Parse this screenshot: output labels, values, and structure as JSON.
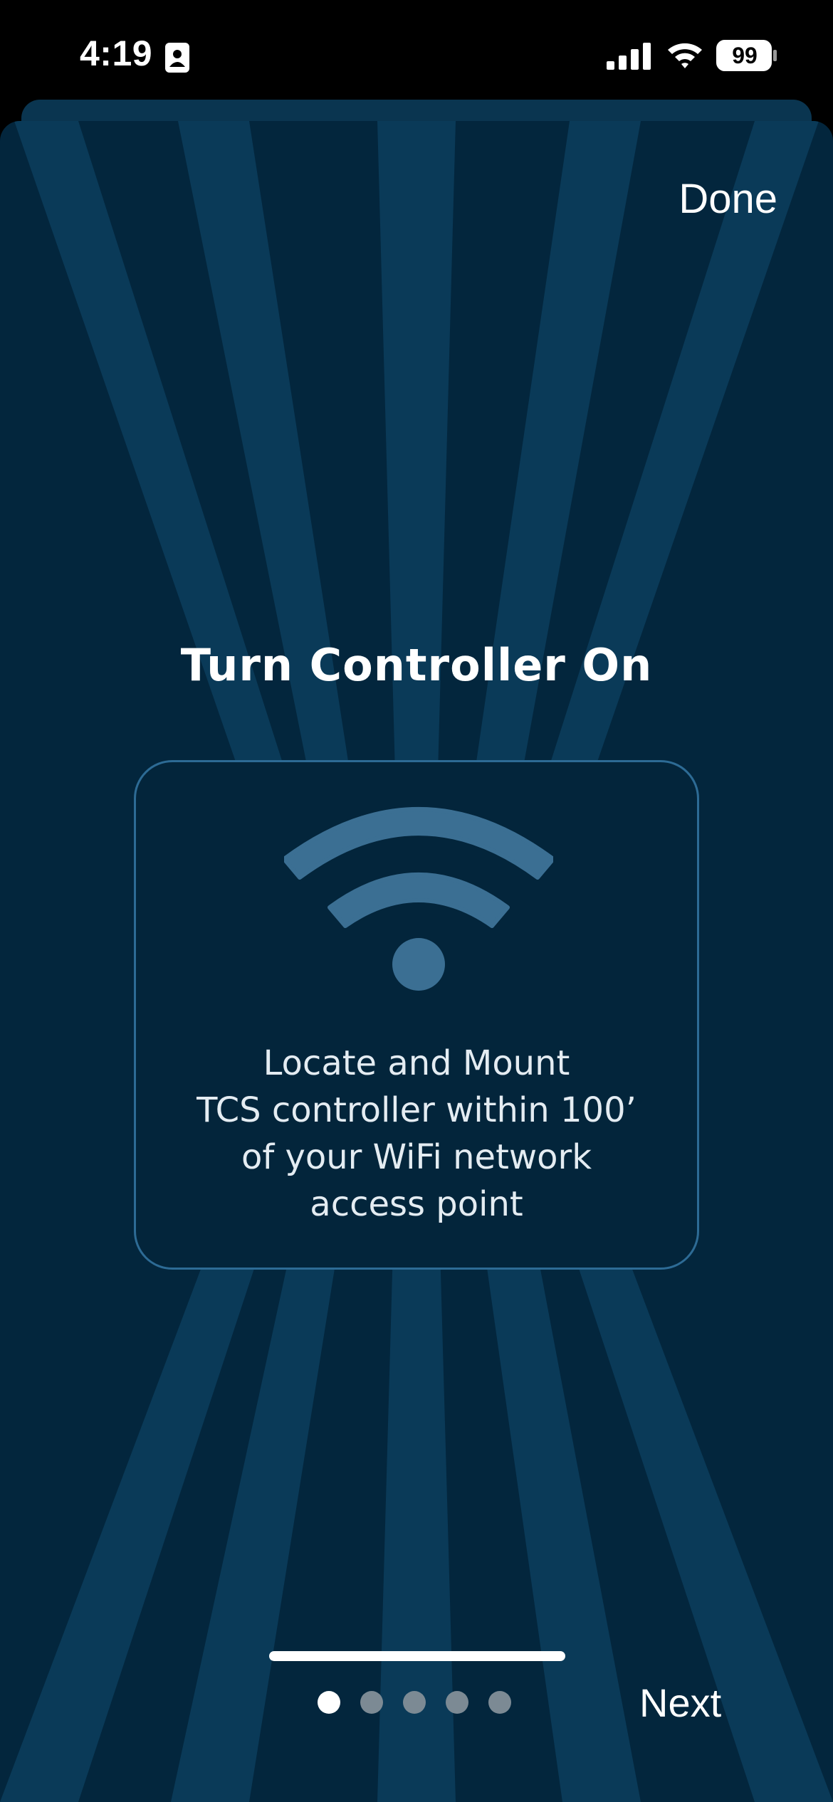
{
  "status_bar": {
    "time": "4:19",
    "battery": "99",
    "icons": [
      "contact-card-icon",
      "cellular-signal-icon",
      "wifi-icon",
      "battery-icon"
    ]
  },
  "header": {
    "done_label": "Done"
  },
  "main": {
    "title": "Turn Controller On",
    "card": {
      "icon": "wifi-icon",
      "lines": [
        "Locate and Mount",
        "TCS controller within 100’",
        "of your WiFi network",
        "access point"
      ]
    }
  },
  "footer": {
    "page_count": 5,
    "current_page": 1,
    "next_label": "Next"
  },
  "colors": {
    "background": "#03263d",
    "ray": "#0a3a58",
    "card_border": "#2d6b95",
    "icon": "#3b6f93"
  }
}
